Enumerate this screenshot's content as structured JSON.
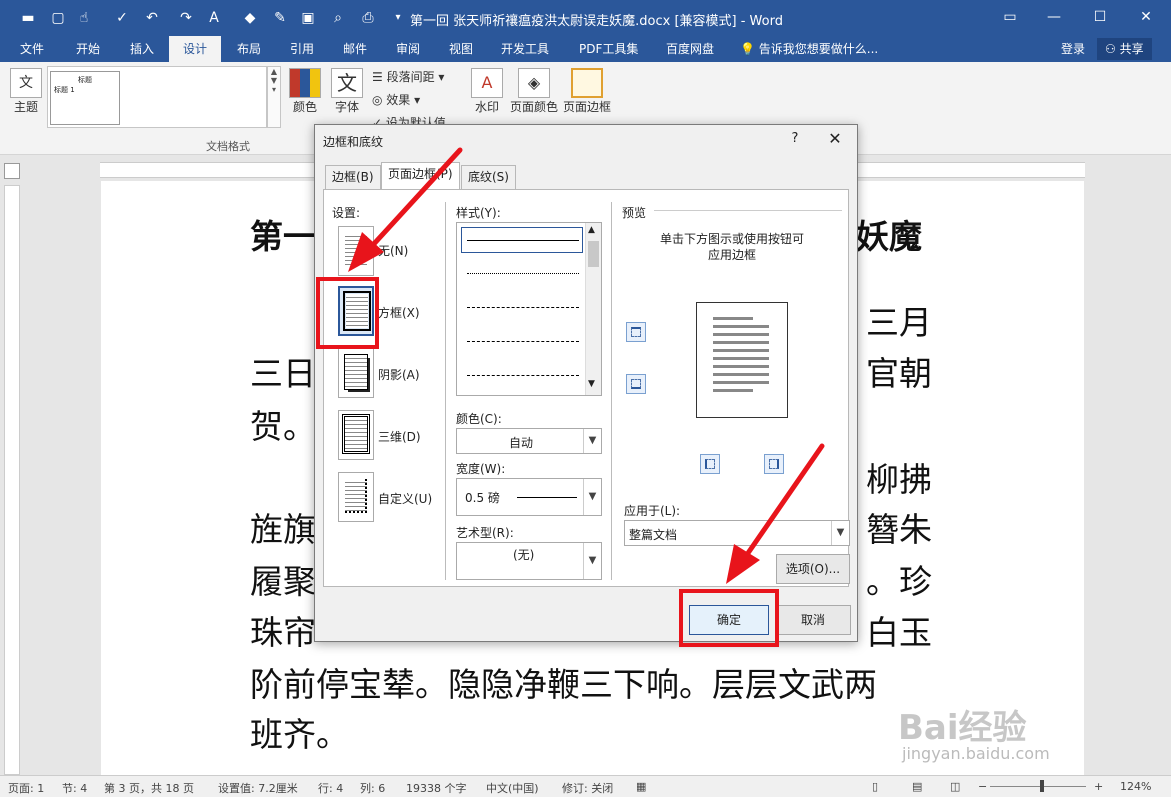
{
  "window": {
    "title": "第一回 张天师祈禳瘟疫洪太尉误走妖魔.docx [兼容模式] - Word",
    "brand_color": "#2b579a"
  },
  "ribbon_tabs": [
    "文件",
    "开始",
    "插入",
    "设计",
    "布局",
    "引用",
    "邮件",
    "审阅",
    "视图",
    "开发工具",
    "PDF工具集",
    "百度网盘"
  ],
  "active_tab": "设计",
  "tell_me": "告诉我您想要做什么...",
  "account": {
    "login": "登录",
    "share": "共享"
  },
  "ribbon": {
    "theme": "主题",
    "gallery_title": "标题",
    "gallery_heading": "标题 1",
    "colors": "颜色",
    "fonts": "字体",
    "paragraph_spacing": "段落间距",
    "effects": "效果",
    "set_default": "设为默认值",
    "watermark": "水印",
    "page_color": "页面颜色",
    "page_borders": "页面边框",
    "group_label": "文档格式"
  },
  "document": {
    "line1_left": "第一",
    "line1_right": "妖魔",
    "line2_right": "三月",
    "line3_left": "三日",
    "line3_right": "官朝",
    "line4": "贺。",
    "line5_right": "柳拂",
    "line6_left": "旌旗",
    "line6_right": "簪朱",
    "line7_left": "履聚",
    "line7_right": "。珍",
    "line8_left": "珠帘",
    "line8_right": "白玉",
    "line9": "阶前停宝辇。隐隐净鞭三下响。层层文武两",
    "line10": "班齐。"
  },
  "dialog": {
    "title": "边框和底纹",
    "help": "?",
    "tabs": [
      "边框(B)",
      "页面边框(P)",
      "底纹(S)"
    ],
    "active_tab": "页面边框(P)",
    "settings_label": "设置:",
    "settings": [
      "无(N)",
      "方框(X)",
      "阴影(A)",
      "三维(D)",
      "自定义(U)"
    ],
    "selected_setting": "方框(X)",
    "style_label": "样式(Y):",
    "color_label": "颜色(C):",
    "color_value": "自动",
    "width_label": "宽度(W):",
    "width_value": "0.5 磅",
    "art_label": "艺术型(R):",
    "art_value": "(无)",
    "preview_label": "预览",
    "preview_hint_1": "单击下方图示或使用按钮可",
    "preview_hint_2": "应用边框",
    "apply_label": "应用于(L):",
    "apply_value": "整篇文档",
    "options_button": "选项(O)...",
    "ok_button": "确定",
    "cancel_button": "取消"
  },
  "statusbar": {
    "page": "页面: 1",
    "section": "节: 4",
    "page_of": "第 3 页，共 18 页",
    "setting": "设置值: 7.2厘米",
    "row": "行: 4",
    "col": "列: 6",
    "chars": "19338 个字",
    "language": "中文(中国)",
    "track": "修订: 关闭",
    "zoom": "124%"
  },
  "watermark": {
    "brand": "Bai经验",
    "url": "jingyan.baidu.com"
  },
  "annotation_color": "#e8141b"
}
